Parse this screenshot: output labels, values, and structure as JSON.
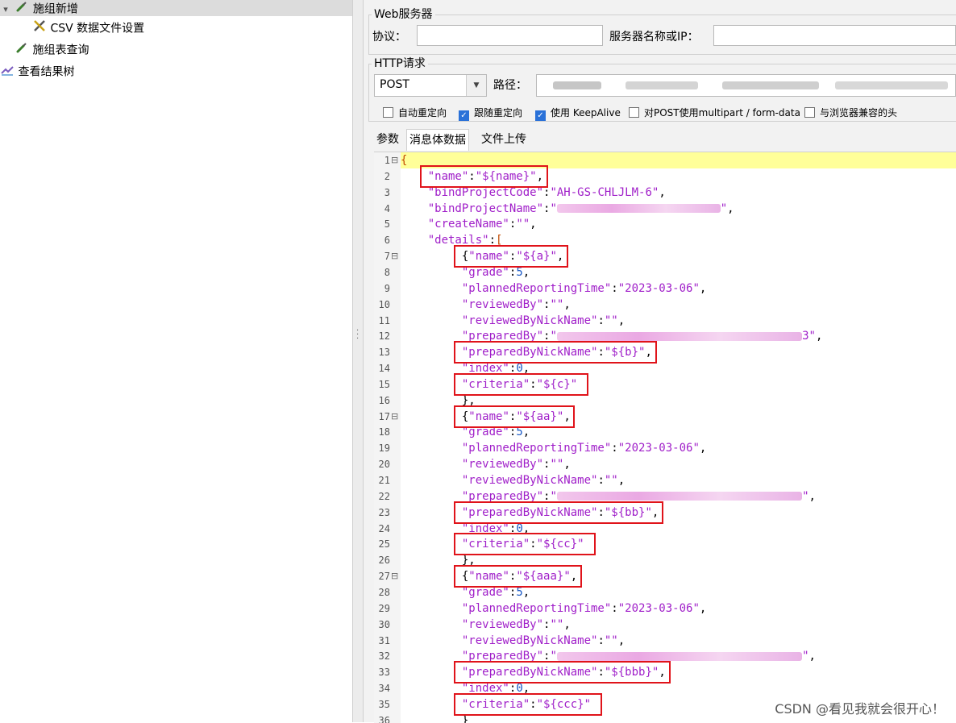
{
  "tree": {
    "items": [
      {
        "label": "施组新增",
        "icon": "pipette-icon",
        "expanded": true,
        "selected": true
      },
      {
        "label": "CSV 数据文件设置",
        "icon": "tools-icon"
      },
      {
        "label": "施组表查询",
        "icon": "pipette-icon"
      },
      {
        "label": "查看结果树",
        "icon": "chart-icon"
      }
    ]
  },
  "web_server": {
    "legend": "Web服务器",
    "protocol_label": "协议：",
    "protocol_value": "",
    "server_label": "服务器名称或IP：",
    "server_value": ""
  },
  "http": {
    "legend": "HTTP请求",
    "method": "POST",
    "path_label": "路径："
  },
  "options": [
    {
      "label": "自动重定向",
      "checked": false
    },
    {
      "label": "跟随重定向",
      "checked": true
    },
    {
      "label": "使用 KeepAlive",
      "checked": true
    },
    {
      "label": "对POST使用multipart / form-data",
      "checked": false
    },
    {
      "label": "与浏览器兼容的头",
      "checked": false
    }
  ],
  "tabs": [
    {
      "label": "参数",
      "active": false
    },
    {
      "label": "消息体数据",
      "active": true
    },
    {
      "label": "文件上传",
      "active": false
    }
  ],
  "colors": {
    "string": "#a01fc9",
    "number": "#1b59c4",
    "highlight_box": "#e0131a",
    "current_line": "#ffff99"
  },
  "editor": {
    "lines": [
      {
        "n": "1",
        "fold": "⊟",
        "indent": 0,
        "t": [
          [
            "{",
            "brk"
          ]
        ]
      },
      {
        "n": "2",
        "indent": 4,
        "t": [
          [
            "\"name\"",
            "str"
          ],
          [
            ":",
            "pun"
          ],
          [
            "\"${name}\"",
            "str"
          ],
          [
            ",",
            "pun"
          ]
        ]
      },
      {
        "n": "3",
        "indent": 4,
        "t": [
          [
            "\"bindProjectCode\"",
            "str"
          ],
          [
            ":",
            "pun"
          ],
          [
            "\"AH-GS-CHLJLM-6\"",
            "str"
          ],
          [
            ",",
            "pun"
          ]
        ]
      },
      {
        "n": "4",
        "indent": 4,
        "t": [
          [
            "\"bindProjectName\"",
            "str"
          ],
          [
            ":",
            "pun"
          ],
          [
            "\"",
            "str"
          ],
          [
            "",
            "blur",
            24
          ],
          [
            "\"",
            "str"
          ],
          [
            ",",
            "pun"
          ]
        ]
      },
      {
        "n": "5",
        "indent": 4,
        "t": [
          [
            "\"createName\"",
            "str"
          ],
          [
            ":",
            "pun"
          ],
          [
            "\"\"",
            "str"
          ],
          [
            ",",
            "pun"
          ]
        ]
      },
      {
        "n": "6",
        "indent": 4,
        "t": [
          [
            "\"details\"",
            "str"
          ],
          [
            ":",
            "pun"
          ],
          [
            "[",
            "brk"
          ]
        ]
      },
      {
        "n": "7",
        "fold": "⊟",
        "indent": 9,
        "t": [
          [
            "{",
            "pun"
          ],
          [
            "\"name\"",
            "str"
          ],
          [
            ":",
            "pun"
          ],
          [
            "\"${a}\"",
            "str"
          ],
          [
            ",",
            "pun"
          ]
        ]
      },
      {
        "n": "8",
        "indent": 9,
        "t": [
          [
            "\"grade\"",
            "str"
          ],
          [
            ":",
            "pun"
          ],
          [
            "5",
            "num"
          ],
          [
            ",",
            "pun"
          ]
        ]
      },
      {
        "n": "9",
        "indent": 9,
        "t": [
          [
            "\"plannedReportingTime\"",
            "str"
          ],
          [
            ":",
            "pun"
          ],
          [
            "\"2023-03-06\"",
            "str"
          ],
          [
            ",",
            "pun"
          ]
        ]
      },
      {
        "n": "10",
        "indent": 9,
        "t": [
          [
            "\"reviewedBy\"",
            "str"
          ],
          [
            ":",
            "pun"
          ],
          [
            "\"\"",
            "str"
          ],
          [
            ",",
            "pun"
          ]
        ]
      },
      {
        "n": "11",
        "indent": 9,
        "t": [
          [
            "\"reviewedByNickName\"",
            "str"
          ],
          [
            ":",
            "pun"
          ],
          [
            "\"\"",
            "str"
          ],
          [
            ",",
            "pun"
          ]
        ]
      },
      {
        "n": "12",
        "indent": 9,
        "t": [
          [
            "\"preparedBy\"",
            "str"
          ],
          [
            ":",
            "pun"
          ],
          [
            "\"",
            "str"
          ],
          [
            "",
            "blur",
            36
          ],
          [
            "3\"",
            "str"
          ],
          [
            ",",
            "pun"
          ]
        ]
      },
      {
        "n": "13",
        "indent": 9,
        "t": [
          [
            "\"preparedByNickName\"",
            "str"
          ],
          [
            ":",
            "pun"
          ],
          [
            "\"${b}\"",
            "str"
          ],
          [
            ",",
            "pun"
          ]
        ]
      },
      {
        "n": "14",
        "indent": 9,
        "t": [
          [
            "\"index\"",
            "str"
          ],
          [
            ":",
            "pun"
          ],
          [
            "0",
            "num"
          ],
          [
            ",",
            "pun"
          ]
        ]
      },
      {
        "n": "15",
        "indent": 9,
        "t": [
          [
            "\"criteria\"",
            "str"
          ],
          [
            ":",
            "pun"
          ],
          [
            "\"${c}\"",
            "str"
          ]
        ]
      },
      {
        "n": "16",
        "indent": 9,
        "t": [
          [
            "},",
            "pun"
          ]
        ]
      },
      {
        "n": "17",
        "fold": "⊟",
        "indent": 9,
        "t": [
          [
            "{",
            "pun"
          ],
          [
            "\"name\"",
            "str"
          ],
          [
            ":",
            "pun"
          ],
          [
            "\"${aa}\"",
            "str"
          ],
          [
            ",",
            "pun"
          ]
        ]
      },
      {
        "n": "18",
        "indent": 9,
        "t": [
          [
            "\"grade\"",
            "str"
          ],
          [
            ":",
            "pun"
          ],
          [
            "5",
            "num"
          ],
          [
            ",",
            "pun"
          ]
        ]
      },
      {
        "n": "19",
        "indent": 9,
        "t": [
          [
            "\"plannedReportingTime\"",
            "str"
          ],
          [
            ":",
            "pun"
          ],
          [
            "\"2023-03-06\"",
            "str"
          ],
          [
            ",",
            "pun"
          ]
        ]
      },
      {
        "n": "20",
        "indent": 9,
        "t": [
          [
            "\"reviewedBy\"",
            "str"
          ],
          [
            ":",
            "pun"
          ],
          [
            "\"\"",
            "str"
          ],
          [
            ",",
            "pun"
          ]
        ]
      },
      {
        "n": "21",
        "indent": 9,
        "t": [
          [
            "\"reviewedByNickName\"",
            "str"
          ],
          [
            ":",
            "pun"
          ],
          [
            "\"\"",
            "str"
          ],
          [
            ",",
            "pun"
          ]
        ]
      },
      {
        "n": "22",
        "indent": 9,
        "t": [
          [
            "\"preparedBy\"",
            "str"
          ],
          [
            ":",
            "pun"
          ],
          [
            "\"",
            "str"
          ],
          [
            "",
            "blur",
            36
          ],
          [
            "\"",
            "str"
          ],
          [
            ",",
            "pun"
          ]
        ]
      },
      {
        "n": "23",
        "indent": 9,
        "t": [
          [
            "\"preparedByNickName\"",
            "str"
          ],
          [
            ":",
            "pun"
          ],
          [
            "\"${bb}\"",
            "str"
          ],
          [
            ",",
            "pun"
          ]
        ]
      },
      {
        "n": "24",
        "indent": 9,
        "t": [
          [
            "\"index\"",
            "str"
          ],
          [
            ":",
            "pun"
          ],
          [
            "0",
            "num"
          ],
          [
            ",",
            "pun"
          ]
        ]
      },
      {
        "n": "25",
        "indent": 9,
        "t": [
          [
            "\"criteria\"",
            "str"
          ],
          [
            ":",
            "pun"
          ],
          [
            "\"${cc}\"",
            "str"
          ]
        ]
      },
      {
        "n": "26",
        "indent": 9,
        "t": [
          [
            "},",
            "pun"
          ]
        ]
      },
      {
        "n": "27",
        "fold": "⊟",
        "indent": 9,
        "t": [
          [
            "{",
            "pun"
          ],
          [
            "\"name\"",
            "str"
          ],
          [
            ":",
            "pun"
          ],
          [
            "\"${aaa}\"",
            "str"
          ],
          [
            ",",
            "pun"
          ]
        ]
      },
      {
        "n": "28",
        "indent": 9,
        "t": [
          [
            "\"grade\"",
            "str"
          ],
          [
            ":",
            "pun"
          ],
          [
            "5",
            "num"
          ],
          [
            ",",
            "pun"
          ]
        ]
      },
      {
        "n": "29",
        "indent": 9,
        "t": [
          [
            "\"plannedReportingTime\"",
            "str"
          ],
          [
            ":",
            "pun"
          ],
          [
            "\"2023-03-06\"",
            "str"
          ],
          [
            ",",
            "pun"
          ]
        ]
      },
      {
        "n": "30",
        "indent": 9,
        "t": [
          [
            "\"reviewedBy\"",
            "str"
          ],
          [
            ":",
            "pun"
          ],
          [
            "\"\"",
            "str"
          ],
          [
            ",",
            "pun"
          ]
        ]
      },
      {
        "n": "31",
        "indent": 9,
        "t": [
          [
            "\"reviewedByNickName\"",
            "str"
          ],
          [
            ":",
            "pun"
          ],
          [
            "\"\"",
            "str"
          ],
          [
            ",",
            "pun"
          ]
        ]
      },
      {
        "n": "32",
        "indent": 9,
        "t": [
          [
            "\"preparedBy\"",
            "str"
          ],
          [
            ":",
            "pun"
          ],
          [
            "\"",
            "str"
          ],
          [
            "",
            "blur",
            36
          ],
          [
            "\"",
            "str"
          ],
          [
            ",",
            "pun"
          ]
        ]
      },
      {
        "n": "33",
        "indent": 9,
        "t": [
          [
            "\"preparedByNickName\"",
            "str"
          ],
          [
            ":",
            "pun"
          ],
          [
            "\"${bbb}\"",
            "str"
          ],
          [
            ",",
            "pun"
          ]
        ]
      },
      {
        "n": "34",
        "indent": 9,
        "t": [
          [
            "\"index\"",
            "str"
          ],
          [
            ":",
            "pun"
          ],
          [
            "0",
            "num"
          ],
          [
            ",",
            "pun"
          ]
        ]
      },
      {
        "n": "35",
        "indent": 9,
        "t": [
          [
            "\"criteria\"",
            "str"
          ],
          [
            ":",
            "pun"
          ],
          [
            "\"${ccc}\"",
            "str"
          ]
        ]
      },
      {
        "n": "36",
        "indent": 9,
        "t": [
          [
            "}",
            "pun"
          ]
        ]
      }
    ]
  },
  "watermark": "CSDN @看见我就会很开心！"
}
